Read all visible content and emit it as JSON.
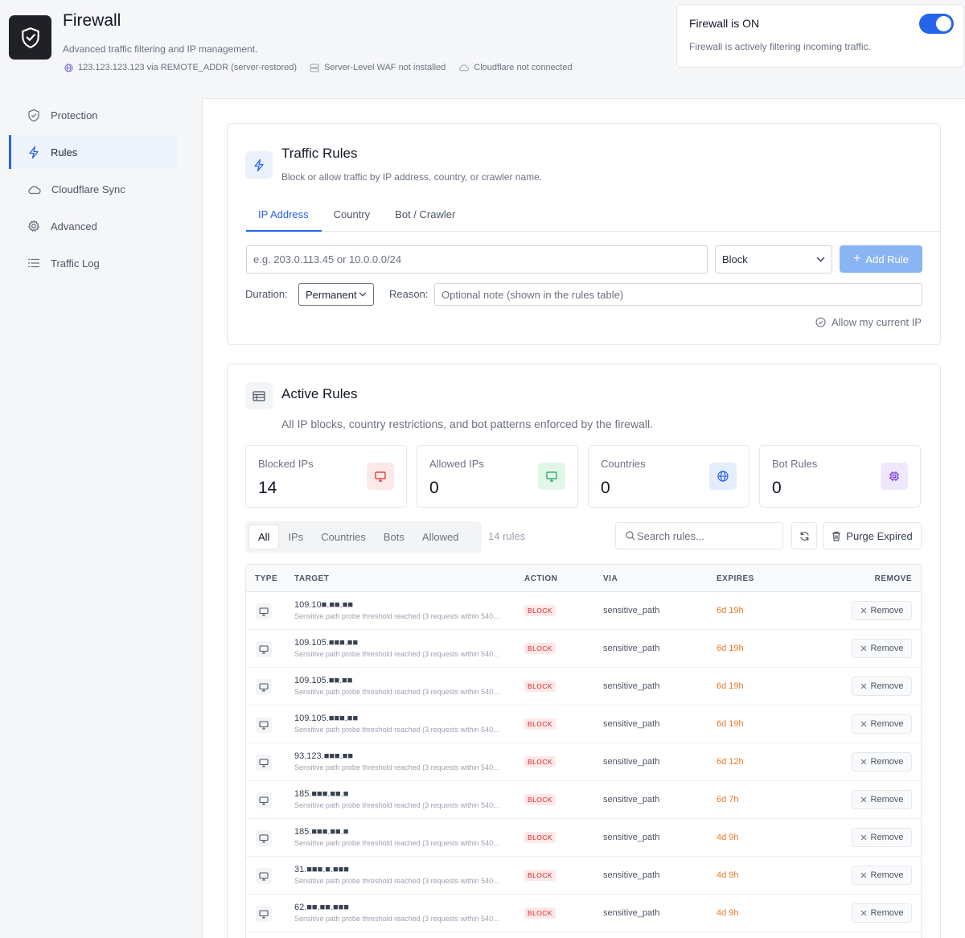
{
  "header": {
    "title": "Firewall",
    "subtitle": "Advanced traffic filtering and IP management.",
    "ip_info": "123.123.123.123 via REMOTE_ADDR (server-restored)",
    "waf_status": "Server-Level WAF not installed",
    "cloudflare_status": "Cloudflare not connected"
  },
  "status": {
    "title": "Firewall is ON",
    "description": "Firewall is actively filtering incoming traffic.",
    "enabled": true
  },
  "sidebar": {
    "items": [
      {
        "label": "Protection",
        "icon": "shield-icon"
      },
      {
        "label": "Rules",
        "icon": "lightning-icon",
        "active": true
      },
      {
        "label": "Cloudflare Sync",
        "icon": "cloud-icon"
      },
      {
        "label": "Advanced",
        "icon": "gear-icon"
      },
      {
        "label": "Traffic Log",
        "icon": "list-icon"
      }
    ]
  },
  "traffic_rules": {
    "title": "Traffic Rules",
    "subtitle": "Block or allow traffic by IP address, country, or crawler name.",
    "tabs": [
      "IP Address",
      "Country",
      "Bot / Crawler"
    ],
    "active_tab": "IP Address",
    "ip_placeholder": "e.g. 203.0.113.45 or 10.0.0.0/24",
    "action_value": "Block",
    "add_button": "Add Rule",
    "duration_label": "Duration:",
    "duration_value": "Permanent",
    "reason_label": "Reason:",
    "reason_placeholder": "Optional note (shown in the rules table)",
    "allow_current_ip": "Allow my current IP"
  },
  "active_rules": {
    "title": "Active Rules",
    "subtitle": "All IP blocks, country restrictions, and bot patterns enforced by the firewall.",
    "stats": [
      {
        "label": "Blocked IPs",
        "value": "14",
        "color": "#dc2626"
      },
      {
        "label": "Allowed IPs",
        "value": "0",
        "color": "#16a34a"
      },
      {
        "label": "Countries",
        "value": "0",
        "color": "#2563eb"
      },
      {
        "label": "Bot Rules",
        "value": "0",
        "color": "#7c3aed"
      }
    ],
    "filters": [
      "All",
      "IPs",
      "Countries",
      "Bots",
      "Allowed"
    ],
    "active_filter": "All",
    "rules_count": "14 rules",
    "search_placeholder": "Search rules...",
    "purge_button": "Purge Expired",
    "columns": [
      "TYPE",
      "TARGET",
      "ACTION",
      "VIA",
      "EXPIRES",
      "REMOVE"
    ],
    "rows": [
      {
        "target": "109.10■.■■.■■",
        "reason": "Sensitive path probe threshold reached (3 requests within 540...",
        "action": "BLOCK",
        "via": "sensitive_path",
        "expires": "6d 19h",
        "remove": "Remove"
      },
      {
        "target": "109.105.■■■.■■",
        "reason": "Sensitive path probe threshold reached (3 requests within 540...",
        "action": "BLOCK",
        "via": "sensitive_path",
        "expires": "6d 19h",
        "remove": "Remove"
      },
      {
        "target": "109.105.■■.■■",
        "reason": "Sensitive path probe threshold reached (3 requests within 540...",
        "action": "BLOCK",
        "via": "sensitive_path",
        "expires": "6d 19h",
        "remove": "Remove"
      },
      {
        "target": "109.105.■■■.■■",
        "reason": "Sensitive path probe threshold reached (3 requests within 540...",
        "action": "BLOCK",
        "via": "sensitive_path",
        "expires": "6d 19h",
        "remove": "Remove"
      },
      {
        "target": "93.123.■■■.■■",
        "reason": "Sensitive path probe threshold reached (3 requests within 540...",
        "action": "BLOCK",
        "via": "sensitive_path",
        "expires": "6d 12h",
        "remove": "Remove"
      },
      {
        "target": "185.■■■.■■.■",
        "reason": "Sensitive path probe threshold reached (3 requests within 540...",
        "action": "BLOCK",
        "via": "sensitive_path",
        "expires": "6d 7h",
        "remove": "Remove"
      },
      {
        "target": "185.■■■.■■.■",
        "reason": "Sensitive path probe threshold reached (3 requests within 540...",
        "action": "BLOCK",
        "via": "sensitive_path",
        "expires": "4d 9h",
        "remove": "Remove"
      },
      {
        "target": "31.■■■.■.■■■",
        "reason": "Sensitive path probe threshold reached (3 requests within 540...",
        "action": "BLOCK",
        "via": "sensitive_path",
        "expires": "4d 9h",
        "remove": "Remove"
      },
      {
        "target": "62.■■.■■.■■■",
        "reason": "Sensitive path probe threshold reached (3 requests within 540...",
        "action": "BLOCK",
        "via": "sensitive_path",
        "expires": "4d 9h",
        "remove": "Remove"
      }
    ]
  }
}
